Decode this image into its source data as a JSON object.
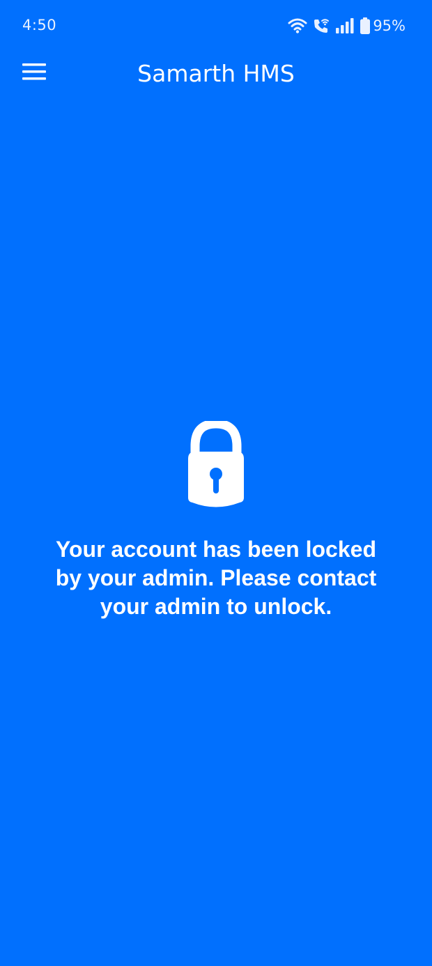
{
  "status_bar": {
    "time": "4:50",
    "icons": [
      "wifi-icon",
      "wifi-call-icon",
      "signal-icon",
      "battery-icon"
    ],
    "battery_percent": "95%"
  },
  "app_bar": {
    "title": "Samarth HMS",
    "menu_icon": "hamburger-menu-icon"
  },
  "locked_screen": {
    "icon": "lock-icon",
    "message": "Your account has been locked by your admin. Please contact your admin to unlock."
  },
  "colors": {
    "background": "#0170FE",
    "foreground": "#FFFFFF"
  }
}
